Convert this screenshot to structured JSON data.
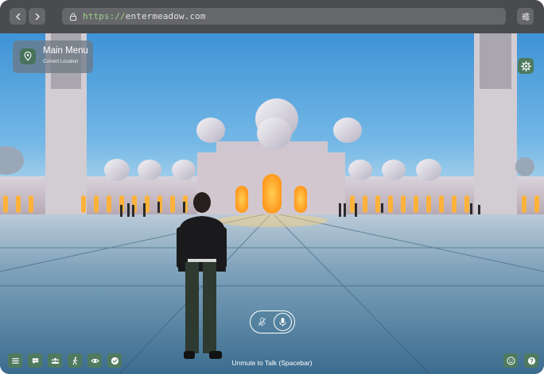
{
  "browser": {
    "url_scheme": "https://",
    "url_host": "entermeadow.com",
    "icons": [
      "back-icon",
      "forward-icon",
      "lock-icon",
      "sliders-icon"
    ]
  },
  "location_card": {
    "title": "Main Menu",
    "subtitle": "Current Location",
    "icon": "location-pin-icon"
  },
  "voice": {
    "hint": "Unmute to Talk (Spacebar)",
    "muted": true,
    "icons": [
      "mic-off-icon",
      "mic-icon"
    ]
  },
  "toolbar": {
    "left_icons": [
      "menu-icon",
      "chat-icon",
      "people-icon",
      "walk-icon",
      "eye-icon",
      "check-circle-icon"
    ],
    "right_icons": [
      "emoji-icon",
      "help-icon"
    ]
  },
  "colors": {
    "accent_green": "#4f7a5f",
    "chrome": "#4a4b4e",
    "address_bar": "#66676a",
    "url_scheme_green": "#9ad18b"
  }
}
